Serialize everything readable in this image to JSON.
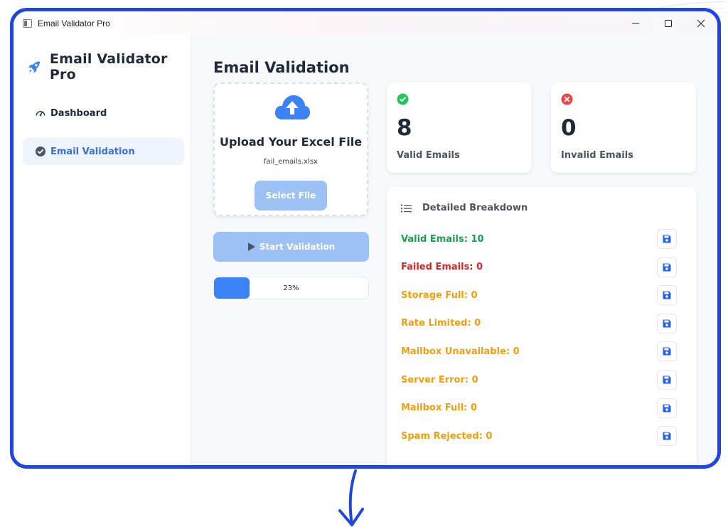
{
  "window": {
    "title": "Email Validator Pro"
  },
  "sidebar": {
    "brand": "Email Validator Pro",
    "items": [
      {
        "label": "Dashboard",
        "icon": "gauge-icon",
        "active": false
      },
      {
        "label": "Email Validation",
        "icon": "check-circle-icon",
        "active": true
      }
    ]
  },
  "main": {
    "title": "Email Validation",
    "upload": {
      "title": "Upload Your Excel File",
      "filename": "fail_emails.xlsx",
      "select_label": "Select File"
    },
    "start_label": "Start Validation",
    "progress": {
      "value": 0.23,
      "label": "23%"
    },
    "stats": {
      "valid": {
        "value": "8",
        "label": "Valid Emails",
        "color": "#16a34a"
      },
      "invalid": {
        "value": "0",
        "label": "Invalid Emails",
        "color": "#dc2626"
      }
    },
    "breakdown": {
      "title": "Detailed Breakdown",
      "rows": [
        {
          "label": "Valid Emails: 10",
          "color": "#16a34a"
        },
        {
          "label": "Failed Emails: 0",
          "color": "#dc2626"
        },
        {
          "label": "Storage Full: 0",
          "color": "#f59e0b"
        },
        {
          "label": "Rate Limited: 0",
          "color": "#f59e0b"
        },
        {
          "label": "Mailbox Unavailable: 0",
          "color": "#f59e0b"
        },
        {
          "label": "Server Error: 0",
          "color": "#f59e0b"
        },
        {
          "label": "Mailbox Full: 0",
          "color": "#f59e0b"
        },
        {
          "label": "Spam Rejected: 0",
          "color": "#f59e0b"
        }
      ]
    }
  },
  "colors": {
    "frame": "#1f45e6",
    "accent": "#3b82f6",
    "button_disabled": "#9cc2f5"
  }
}
